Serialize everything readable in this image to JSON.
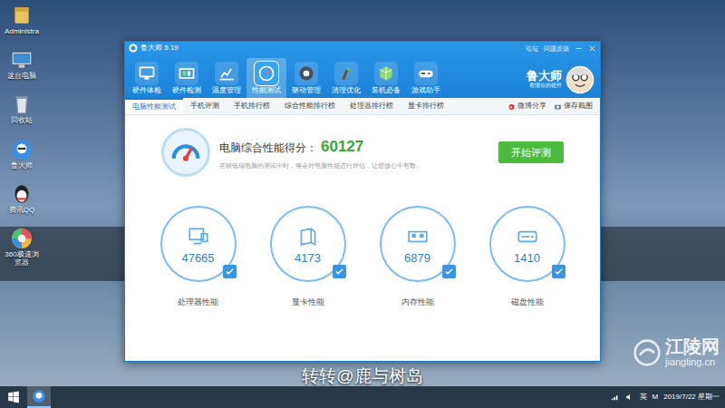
{
  "desktop": {
    "icons": [
      {
        "label": "Administra"
      },
      {
        "label": "这台电脑"
      },
      {
        "label": "回收站"
      },
      {
        "label": "鲁大师"
      },
      {
        "label": "腾讯QQ"
      },
      {
        "label": "360极速浏览器"
      }
    ]
  },
  "window": {
    "title": "鲁大师 5.19",
    "links": [
      "论坛",
      "问题反馈"
    ],
    "toolbar": [
      {
        "label": "硬件体检",
        "selected": false
      },
      {
        "label": "硬件检测",
        "selected": false
      },
      {
        "label": "温度管理",
        "selected": false
      },
      {
        "label": "性能测试",
        "selected": true
      },
      {
        "label": "驱动管理",
        "selected": false
      },
      {
        "label": "清理优化",
        "selected": false
      },
      {
        "label": "装机必备",
        "selected": false
      },
      {
        "label": "游戏助手",
        "selected": false
      }
    ],
    "brand": {
      "name": "鲁大师",
      "slogan": "看懂你的硬件"
    },
    "subtabs": [
      {
        "label": "电脑性能测试",
        "selected": true
      },
      {
        "label": "手机评测",
        "selected": false
      },
      {
        "label": "手机排行榜",
        "selected": false
      },
      {
        "label": "综合性能排行榜",
        "selected": false
      },
      {
        "label": "处理器排行榜",
        "selected": false
      },
      {
        "label": "显卡排行榜",
        "selected": false
      }
    ],
    "actions": [
      "微博分享",
      "保存截图"
    ],
    "score": {
      "label": "电脑综合性能得分：",
      "value": "60127",
      "note": "在较低端电脑的测试中时，将会对电脑性能进行评估，让您放心中有数。"
    },
    "button": "开始评测",
    "metrics": [
      {
        "value": "47665",
        "label": "处理器性能",
        "checked": true
      },
      {
        "value": "4173",
        "label": "显卡性能",
        "checked": true
      },
      {
        "value": "6879",
        "label": "内存性能",
        "checked": true
      },
      {
        "value": "1410",
        "label": "磁盘性能",
        "checked": true
      }
    ]
  },
  "caption": "转转@鹿与树岛",
  "watermark": {
    "name": "江陵网",
    "url": "jiangling.cn"
  },
  "taskbar": {
    "tray": [
      "英",
      "M"
    ],
    "clock": "2019/7/22 星期一"
  }
}
